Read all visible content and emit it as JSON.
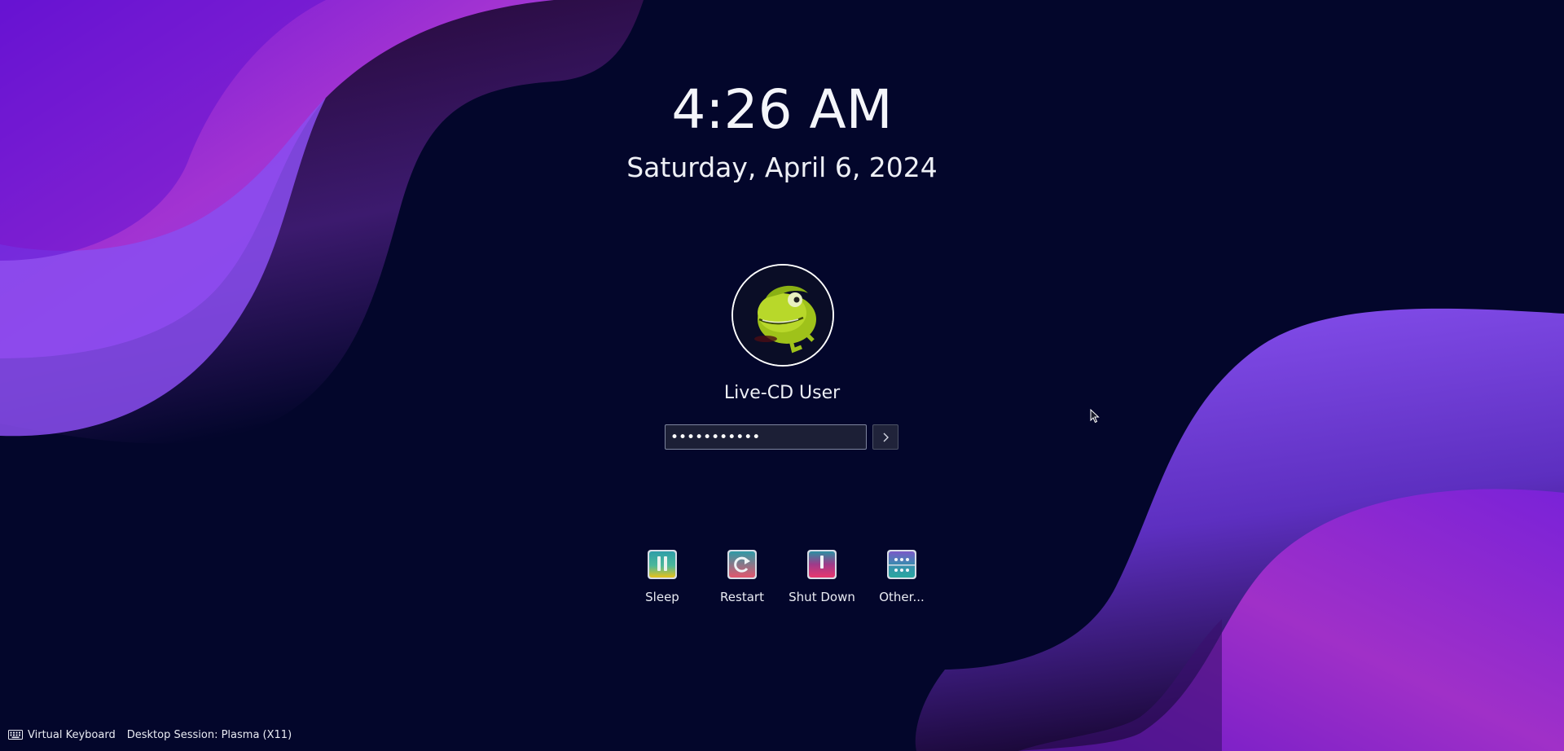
{
  "lockscreen": {
    "time": "4:26 AM",
    "date": "Saturday, April 6, 2024"
  },
  "user": {
    "name": "Live-CD User",
    "avatar_icon": "chameleon-avatar-icon"
  },
  "password": {
    "value": "•••••••••••",
    "login_icon": "chevron-right-icon"
  },
  "actions": [
    {
      "label": "Sleep",
      "icon": "sleep-icon"
    },
    {
      "label": "Restart",
      "icon": "restart-icon"
    },
    {
      "label": "Shut Down",
      "icon": "shutdown-icon"
    },
    {
      "label": "Other...",
      "icon": "other-icon"
    }
  ],
  "footer": {
    "virtual_keyboard": "Virtual Keyboard",
    "session": "Desktop Session: Plasma (X11)"
  },
  "colors": {
    "background": "#03062b",
    "wave_purple": "#7b2fe0",
    "wave_magenta": "#b23ad8"
  }
}
